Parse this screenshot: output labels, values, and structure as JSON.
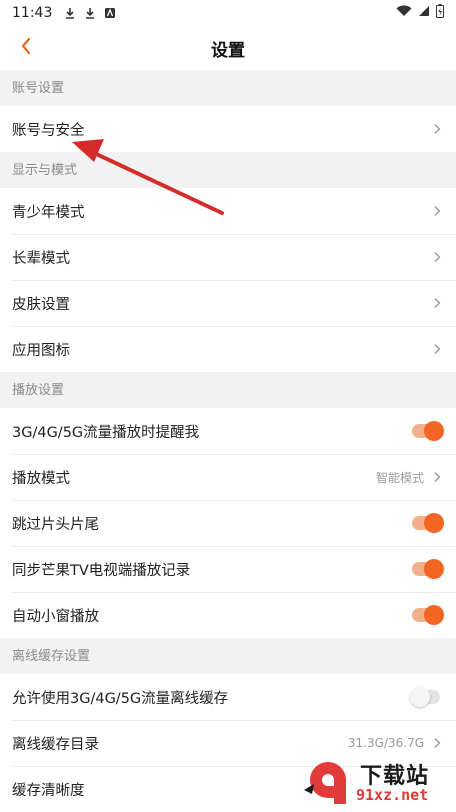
{
  "status": {
    "time": "11:43",
    "left_icons": [
      "download-icon",
      "download-icon",
      "app-icon"
    ],
    "right_icons": [
      "wifi-icon",
      "signal-icon",
      "battery-icon"
    ]
  },
  "nav": {
    "title": "设置",
    "back_icon": "chevron-left-icon"
  },
  "sections": {
    "account": {
      "header": "账号设置",
      "items": {
        "account_security": "账号与安全"
      }
    },
    "display": {
      "header": "显示与模式",
      "items": {
        "youth_mode": "青少年模式",
        "elder_mode": "长辈模式",
        "skin": "皮肤设置",
        "app_icon": "应用图标"
      }
    },
    "playback": {
      "header": "播放设置",
      "items": {
        "mobile_remind": {
          "label": "3G/4G/5G流量播放时提醒我",
          "enabled": true
        },
        "play_mode": {
          "label": "播放模式",
          "value": "智能模式"
        },
        "skip_intro": {
          "label": "跳过片头片尾",
          "enabled": true
        },
        "tv_sync": {
          "label": "同步芒果TV电视端播放记录",
          "enabled": true
        },
        "mini_window": {
          "label": "自动小窗播放",
          "enabled": true
        }
      }
    },
    "offline": {
      "header": "离线缓存设置",
      "items": {
        "allow_mobile_cache": {
          "label": "允许使用3G/4G/5G流量离线缓存",
          "enabled": false
        },
        "cache_dir": {
          "label": "离线缓存目录",
          "value": "31.3G/36.7G"
        },
        "cache_quality": {
          "label": "缓存清晰度"
        }
      }
    }
  },
  "watermark": {
    "title": "下载站",
    "site": "91xz.net"
  },
  "colors": {
    "accent": "#f26522",
    "arrow": "#d42b2b",
    "back": "#f26522"
  }
}
